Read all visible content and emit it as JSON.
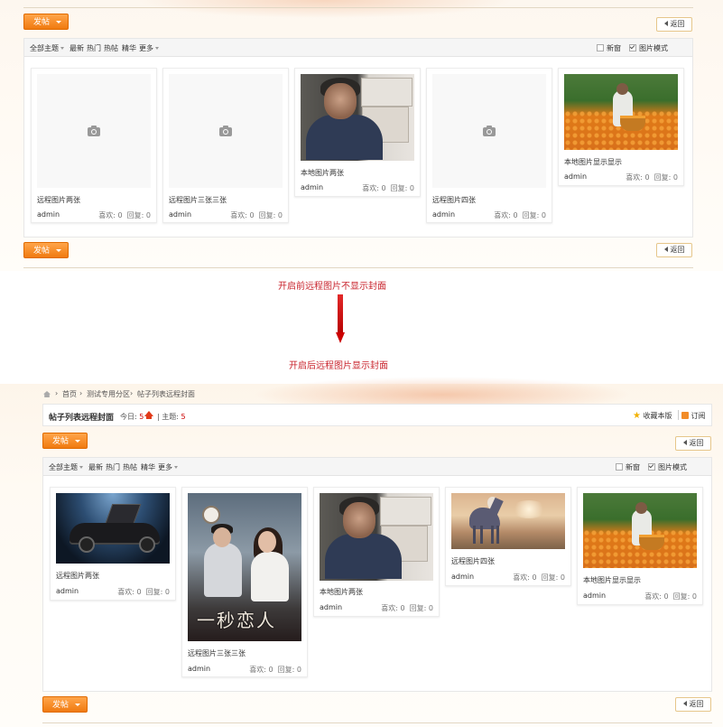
{
  "colors": {
    "accent": "#f07a10",
    "caption": "#c8232c",
    "up_arrow": "#e23a1a"
  },
  "toolbar": {
    "post_label": "发帖",
    "back_label": "返回"
  },
  "filters": {
    "items": [
      "全部主题",
      "最新",
      "热门",
      "热帖",
      "精华",
      "更多"
    ],
    "new_label": "新窗",
    "image_mode_label": "图片模式",
    "new_checked": false,
    "image_mode_checked": true
  },
  "before": {
    "cards": [
      {
        "title": "远程图片两张",
        "author": "admin",
        "likes": "喜欢: 0",
        "replies": "回复: 0",
        "image": "placeholder"
      },
      {
        "title": "远程图片三张三张",
        "author": "admin",
        "likes": "喜欢: 0",
        "replies": "回复: 0",
        "image": "placeholder"
      },
      {
        "title": "本地图片两张",
        "author": "admin",
        "likes": "喜欢: 0",
        "replies": "回复: 0",
        "image": "old-woman-photo"
      },
      {
        "title": "远程图片四张",
        "author": "admin",
        "likes": "喜欢: 0",
        "replies": "回复: 0",
        "image": "placeholder"
      },
      {
        "title": "本地图片显示显示",
        "author": "admin",
        "likes": "喜欢: 0",
        "replies": "回复: 0",
        "image": "flower-field-photo"
      }
    ]
  },
  "captions": {
    "before": "开启前远程图片不显示封面",
    "after": "开启后远程图片显示封面"
  },
  "breadcrumb": [
    "首页",
    "测试专用分区",
    "帖子列表远程封面"
  ],
  "forum": {
    "title": "帖子列表远程封面",
    "today_label": "今日:",
    "today_value": "5",
    "topics_label": "主题:",
    "topics_value": "5",
    "favorite_label": "收藏本版",
    "subscribe_label": "订阅"
  },
  "after": {
    "cards": [
      {
        "title": "远程图片两张",
        "author": "admin",
        "likes": "喜欢: 0",
        "replies": "回复: 0",
        "image": "sports-car-photo"
      },
      {
        "title": "远程图片三张三张",
        "author": "admin",
        "likes": "喜欢: 0",
        "replies": "回复: 0",
        "image": "movie-poster-photo",
        "poster_text": "一秒恋人"
      },
      {
        "title": "本地图片两张",
        "author": "admin",
        "likes": "喜欢: 0",
        "replies": "回复: 0",
        "image": "old-woman-photo"
      },
      {
        "title": "远程图片四张",
        "author": "admin",
        "likes": "喜欢: 0",
        "replies": "回复: 0",
        "image": "horse-desert-photo"
      },
      {
        "title": "本地图片显示显示",
        "author": "admin",
        "likes": "喜欢: 0",
        "replies": "回复: 0",
        "image": "flower-field-photo"
      }
    ]
  }
}
